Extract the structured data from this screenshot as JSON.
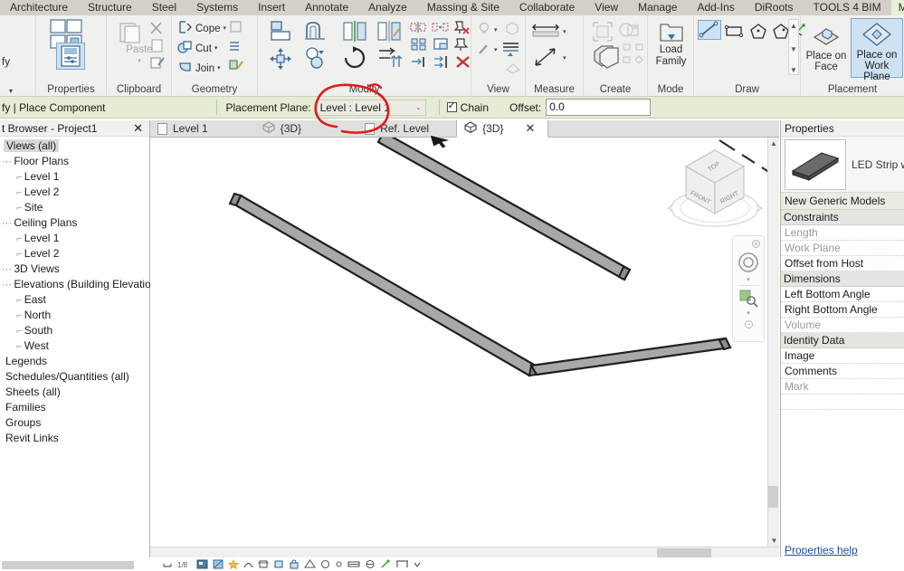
{
  "ribbon_tabs": [
    {
      "label": "Architecture",
      "contextual": false
    },
    {
      "label": "Structure",
      "contextual": false
    },
    {
      "label": "Steel",
      "contextual": false
    },
    {
      "label": "Systems",
      "contextual": false
    },
    {
      "label": "Insert",
      "contextual": false
    },
    {
      "label": "Annotate",
      "contextual": false
    },
    {
      "label": "Analyze",
      "contextual": false
    },
    {
      "label": "Massing & Site",
      "contextual": false
    },
    {
      "label": "Collaborate",
      "contextual": false
    },
    {
      "label": "View",
      "contextual": false
    },
    {
      "label": "Manage",
      "contextual": false
    },
    {
      "label": "Add-Ins",
      "contextual": false
    },
    {
      "label": "DiRoots",
      "contextual": false
    },
    {
      "label": "TOOLS 4 BIM",
      "contextual": false
    },
    {
      "label": "Modify | Place C",
      "contextual": true
    }
  ],
  "ribbon_panels": {
    "modify_label": "fy",
    "properties": {
      "title": "Properties",
      "button_label": "Properties",
      "caret": "▾"
    },
    "clipboard": {
      "title": "Clipboard",
      "paste_label": "Paste",
      "paste_caret": "▾",
      "cut_label": "Cut",
      "copy_label": "Copy",
      "match_label": "Match"
    },
    "geometry": {
      "title": "Geometry",
      "items": [
        "Cope",
        "Cut",
        "Join"
      ],
      "caret": "▾"
    },
    "modify": {
      "title": "Modify"
    },
    "view": {
      "title": "View"
    },
    "measure": {
      "title": "Measure"
    },
    "create": {
      "title": "Create"
    },
    "mode": {
      "title": "Mode",
      "load_family_line1": "Load",
      "load_family_line2": "Family"
    },
    "draw": {
      "title": "Draw"
    },
    "placement": {
      "title": "Placement",
      "place_on_face_line1": "Place on",
      "place_on_face_line2": "Face",
      "place_on_work_plane_line1": "Place on",
      "place_on_work_plane_line2": "Work Plane"
    }
  },
  "options_bar": {
    "context_label": "fy | Place Component",
    "placement_plane_label": "Placement Plane:",
    "placement_plane_value": "Level : Level 1",
    "placement_plane_arrow": "⌄",
    "chain_label": "Chain",
    "chain_checked": true,
    "offset_label": "Offset:",
    "offset_value": "0.0"
  },
  "browser": {
    "title": "t Browser - Project1",
    "close_icon": "✕",
    "tree": [
      {
        "label": "Views (all)",
        "level": 0,
        "selected": true,
        "prefix": ""
      },
      {
        "label": "Floor Plans",
        "level": 1,
        "selected": false,
        "prefix": "⋯"
      },
      {
        "label": "Level 1",
        "level": 2,
        "selected": false,
        "prefix": "⌐"
      },
      {
        "label": "Level 2",
        "level": 2,
        "selected": false,
        "prefix": "⌐"
      },
      {
        "label": "Site",
        "level": 2,
        "selected": false,
        "prefix": "⌐"
      },
      {
        "label": "Ceiling Plans",
        "level": 1,
        "selected": false,
        "prefix": "⋯"
      },
      {
        "label": "Level 1",
        "level": 2,
        "selected": false,
        "prefix": "⌐"
      },
      {
        "label": "Level 2",
        "level": 2,
        "selected": false,
        "prefix": "⌐"
      },
      {
        "label": "3D Views",
        "level": 1,
        "selected": false,
        "prefix": "⋯"
      },
      {
        "label": "Elevations (Building Elevation)",
        "level": 1,
        "selected": false,
        "prefix": "⋯"
      },
      {
        "label": "East",
        "level": 2,
        "selected": false,
        "prefix": "⌐"
      },
      {
        "label": "North",
        "level": 2,
        "selected": false,
        "prefix": "⌐"
      },
      {
        "label": "South",
        "level": 2,
        "selected": false,
        "prefix": "⌐"
      },
      {
        "label": "West",
        "level": 2,
        "selected": false,
        "prefix": "⌐"
      },
      {
        "label": "Legends",
        "level": 1,
        "selected": false,
        "prefix": ""
      },
      {
        "label": "Schedules/Quantities (all)",
        "level": 1,
        "selected": false,
        "prefix": ""
      },
      {
        "label": "Sheets (all)",
        "level": 1,
        "selected": false,
        "prefix": ""
      },
      {
        "label": "Families",
        "level": 1,
        "selected": false,
        "prefix": ""
      },
      {
        "label": "Groups",
        "level": 1,
        "selected": false,
        "prefix": ""
      },
      {
        "label": "Revit Links",
        "level": 1,
        "selected": false,
        "prefix": ""
      }
    ]
  },
  "view_tabs": [
    {
      "label": "Level 1",
      "icon": "sheet-icon",
      "active": false
    },
    {
      "label": "{3D}",
      "icon": "cube-icon",
      "active": false
    },
    {
      "label": "Ref. Level",
      "icon": "sheet-icon",
      "active": false
    },
    {
      "label": "{3D}",
      "icon": "cube-icon",
      "active": true
    }
  ],
  "view_tab_close": "✕",
  "viewcube": {
    "top_label": "TOP",
    "front_label": "FRONT",
    "right_label": "RIGHT"
  },
  "navbar": {
    "steering_wheel": "steering-wheel-icon",
    "zoom": "zoom-icon",
    "caret": "▾"
  },
  "properties": {
    "title": "Properties",
    "element_name": "LED Strip wit",
    "type_selector": "New Generic Models",
    "rows": [
      {
        "label": "Constraints",
        "type": "group"
      },
      {
        "label": "Length",
        "type": "dim"
      },
      {
        "label": "Work Plane",
        "type": "dim"
      },
      {
        "label": "Offset from Host",
        "type": "normal"
      },
      {
        "label": "Dimensions",
        "type": "group"
      },
      {
        "label": "Left Bottom Angle",
        "type": "normal"
      },
      {
        "label": "Right Bottom Angle",
        "type": "normal"
      },
      {
        "label": "Volume",
        "type": "dim"
      },
      {
        "label": "Identity Data",
        "type": "group"
      },
      {
        "label": "Image",
        "type": "normal"
      },
      {
        "label": "Comments",
        "type": "normal"
      },
      {
        "label": "Mark",
        "type": "dim"
      },
      {
        "label": "",
        "type": "normal"
      }
    ],
    "help_link": "Properties help"
  },
  "colors": {
    "ribbon_tab_bar": "#d4d0c8",
    "ribbon_bg": "#f0f0ef",
    "contextual_tab": "#e9efd9",
    "options_bar": "#e4ecd4",
    "annotation_red": "#e01b1b",
    "selected_blue": "#cfe2f3",
    "link_blue": "#1a4f9c"
  },
  "model": {
    "description": "Three LED strip segments drawn in isometric 3D view"
  }
}
